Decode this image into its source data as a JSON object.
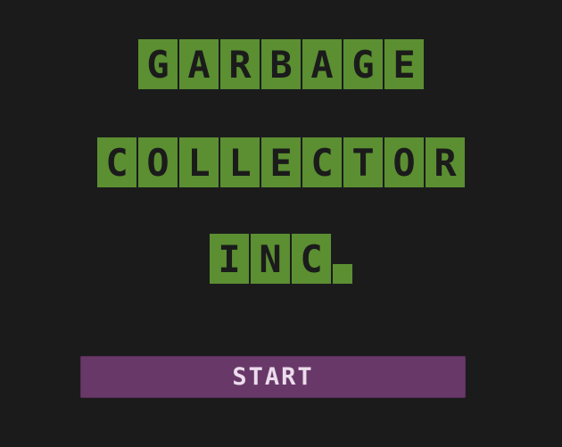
{
  "title": {
    "line1": "GARBAGE",
    "line2": "COLLECTOR",
    "line3": "INC."
  },
  "start_button": {
    "label": "START"
  },
  "colors": {
    "background": "#1b1b1c",
    "title_green": "#5b8f31",
    "button_purple": "#683968",
    "button_text": "#ecdcec"
  }
}
